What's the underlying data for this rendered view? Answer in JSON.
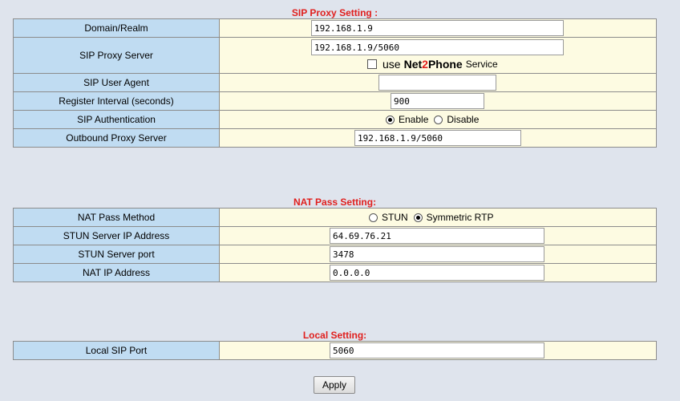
{
  "sip": {
    "title": "SIP Proxy Setting :",
    "domain_label": "Domain/Realm",
    "domain_value": "192.168.1.9",
    "proxy_label": "SIP Proxy Server",
    "proxy_value": "192.168.1.9/5060",
    "use_text": "use",
    "brand_pre": "Net",
    "brand_two": "2",
    "brand_post": "Phone",
    "service_text": "Service",
    "user_agent_label": "SIP User Agent",
    "user_agent_value": "",
    "register_label": "Register Interval (seconds)",
    "register_value": "900",
    "auth_label": "SIP Authentication",
    "auth_enable": "Enable",
    "auth_disable": "Disable",
    "auth_selected": "Enable",
    "outbound_label": "Outbound Proxy Server",
    "outbound_value": "192.168.1.9/5060"
  },
  "nat": {
    "title": "NAT Pass Setting:",
    "method_label": "NAT Pass Method",
    "opt_stun": "STUN",
    "opt_symmetric": "Symmetric RTP",
    "method_selected": "Symmetric RTP",
    "stun_ip_label": "STUN Server IP Address",
    "stun_ip_value": "64.69.76.21",
    "stun_port_label": "STUN Server port",
    "stun_port_value": "3478",
    "nat_ip_label": "NAT IP Address",
    "nat_ip_value": "0.0.0.0"
  },
  "local": {
    "title": "Local Setting:",
    "port_label": "Local SIP Port",
    "port_value": "5060"
  },
  "apply_label": "Apply",
  "colors": {
    "page_bg": "#dfe4ed",
    "label_bg": "#c0dcf2",
    "value_bg": "#fdfbe2",
    "title_red": "#e0201e"
  }
}
